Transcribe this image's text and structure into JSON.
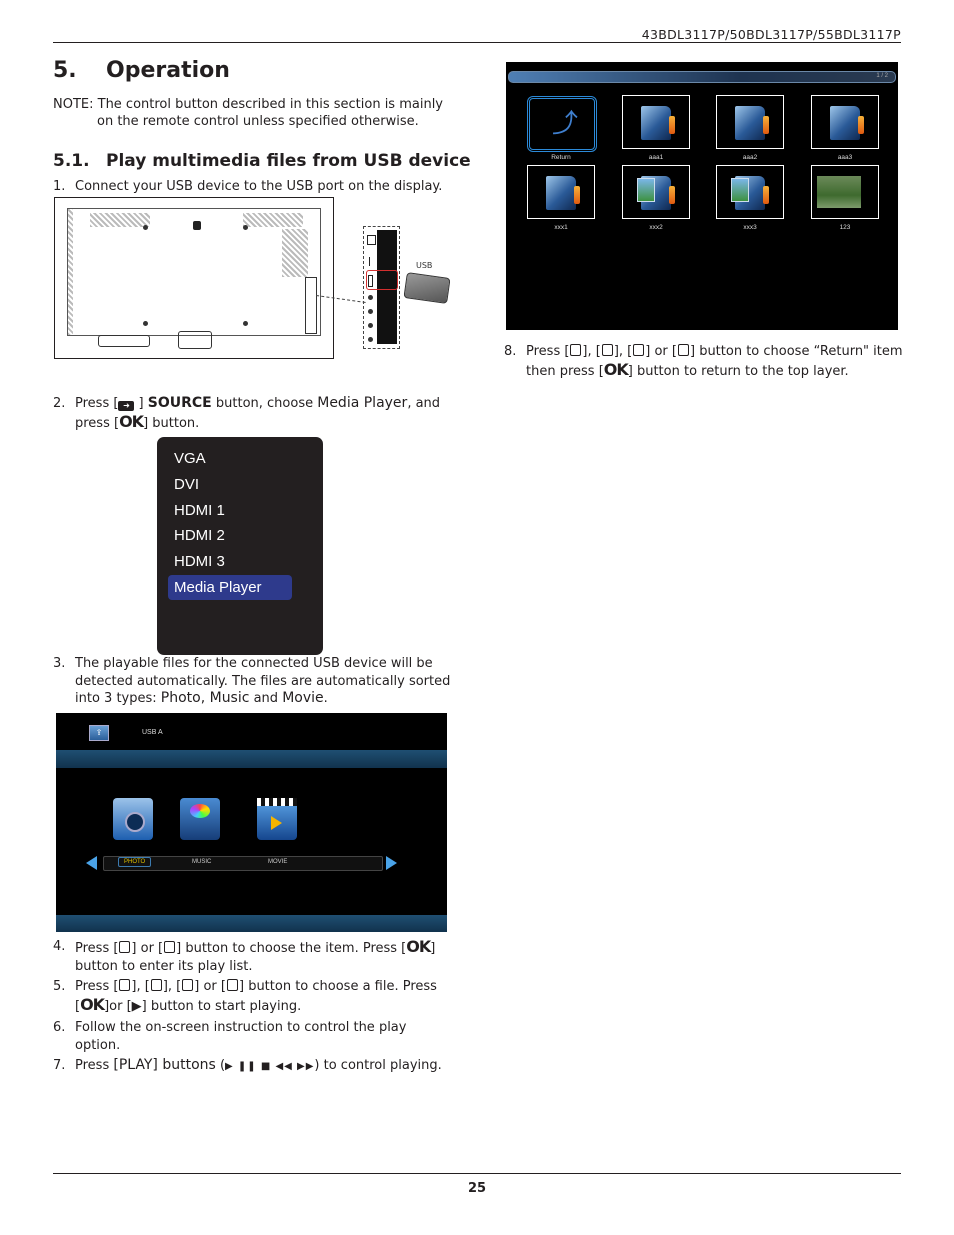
{
  "header": {
    "model_text": "43BDL3117P/50BDL3117P/55BDL3117P"
  },
  "footer": {
    "page_number": "25"
  },
  "section": {
    "number": "5.",
    "title": "Operation"
  },
  "note": {
    "line1": "NOTE: The control button described in this section is mainly",
    "line2": "on the remote control unless specified otherwise."
  },
  "subsection": {
    "number": "5.1.",
    "title": "Play multimedia files from USB device"
  },
  "steps": {
    "s1": {
      "num": "1.",
      "text": "Connect your USB device to the USB port on the display."
    },
    "s2": {
      "num": "2.",
      "pre": "Press [",
      "mid": " ] ",
      "source": "SOURCE",
      "t1": " button, choose ",
      "mp": "Media Player",
      "t2": ", and",
      "t3": "press [",
      "ok": "OK",
      "t4": "] button."
    },
    "s3": {
      "num": "3.",
      "line1": "The playable files for the connected USB device will be",
      "line2": "detected automatically. The files are automatically sorted",
      "pre": "into 3 types:  ",
      "photo": "Photo",
      "comma": ", ",
      "music": "Music",
      "and": " and ",
      "movie": "Movie",
      "end": "."
    },
    "s4": {
      "num": "4.",
      "p1": "Press [",
      "p2": "] or [",
      "p3": "] button to choose the item. Press [",
      "ok": "OK",
      "p4": "]",
      "line2": "button to enter its play list."
    },
    "s5": {
      "num": "5.",
      "p1": "Press [",
      "p2": "], [",
      "p3": "], [",
      "p4": "] or [",
      "p5": "] button to choose a file. Press",
      "p6": "[",
      "ok": "OK",
      "p7": "]or [",
      "play": "▶",
      "p8": "] button to start playing."
    },
    "s6": {
      "num": "6.",
      "line1": "Follow the on-screen instruction to control the play",
      "line2": "option."
    },
    "s7": {
      "num": "7.",
      "pre": "Press ",
      "bold": "[PLAY] buttons",
      "open": " (",
      "icons": "▶ ❚❚ ■ ◀◀ ▶▶",
      "post": ") to control playing."
    },
    "s8": {
      "num": "8.",
      "p1": "Press [",
      "p2": "], [",
      "p3": "], [",
      "p4": "] or [",
      "p5": "] button to choose “Return\" item",
      "p6": "then press [",
      "ok": "OK",
      "p7": "] button to return to the top layer."
    }
  },
  "diagram": {
    "usb_label": "USB"
  },
  "source_menu": {
    "items": [
      "VGA",
      "DVI",
      "HDMI 1",
      "HDMI 2",
      "HDMI 3",
      "Media Player"
    ],
    "selected": "Media Player",
    "selected_color": "#2e3a8c"
  },
  "media_screen": {
    "device_name": "USB A",
    "categories": [
      "PHOTO",
      "MUSIC",
      "MOVIE"
    ],
    "selected": "PHOTO",
    "selected_color": "#e0c200"
  },
  "file_browser": {
    "page_indicator": "1 / 2",
    "items": [
      {
        "label": "Return",
        "type": "return"
      },
      {
        "label": "aaa1",
        "type": "folder"
      },
      {
        "label": "aaa2",
        "type": "folder"
      },
      {
        "label": "aaa3",
        "type": "folder"
      },
      {
        "label": "xxx1",
        "type": "folder"
      },
      {
        "label": "xxx2",
        "type": "photo-folder"
      },
      {
        "label": "xxx3",
        "type": "photo-folder"
      },
      {
        "label": "123",
        "type": "photo"
      }
    ]
  }
}
